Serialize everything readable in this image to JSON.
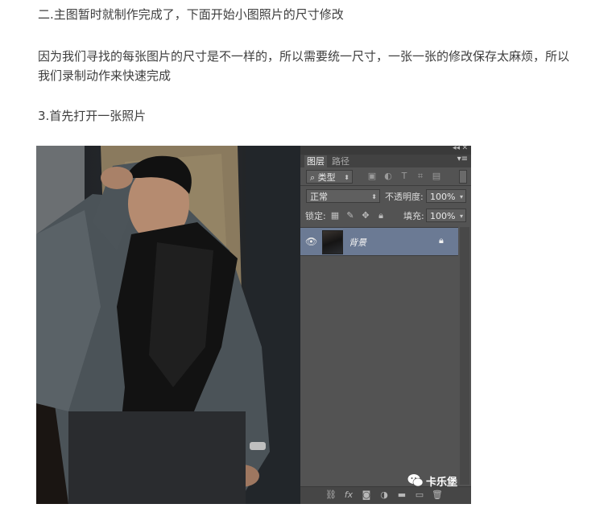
{
  "article": {
    "para1": "二.主图暂时就制作完成了，下面开始小图照片的尺寸修改",
    "para2": "因为我们寻找的每张图片的尺寸是不一样的，所以需要统一尺寸，一张一张的修改保存太麻烦，所以我们录制动作来快速完成",
    "para3": "3.首先打开一张照片"
  },
  "panel": {
    "collapse": "◂◂",
    "close": "✕",
    "tabs": [
      "图层",
      "路径"
    ],
    "menu": "▾≡",
    "filter_label": "⌕ 类型",
    "blend_mode": "正常",
    "opacity_label": "不透明度:",
    "opacity_value": "100%",
    "lock_label": "锁定:",
    "fill_label": "填充:",
    "fill_value": "100%",
    "layer_name": "背景"
  },
  "watermark": {
    "text": "卡乐堡"
  },
  "colors": {
    "panel_bg": "#535353",
    "layer_selected": "#6b7a94",
    "text": "#3e3e3e"
  }
}
